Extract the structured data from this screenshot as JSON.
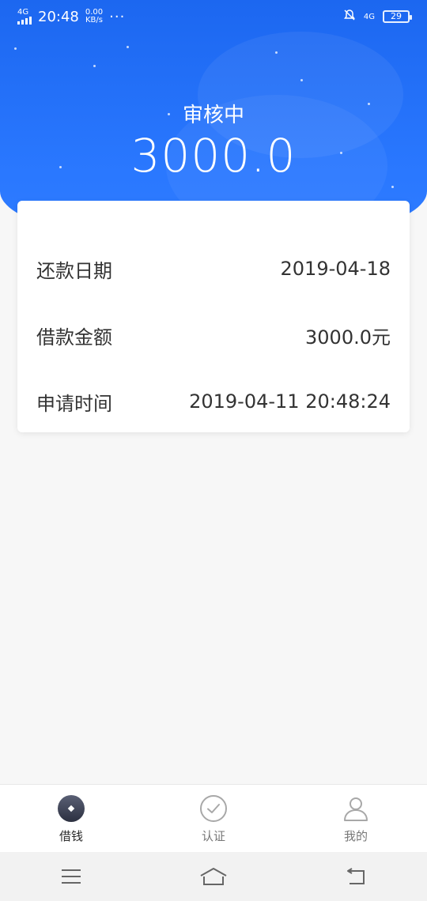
{
  "status_bar": {
    "network": "4G",
    "time": "20:48",
    "speed_value": "0.00",
    "speed_unit": "KB/s",
    "more": "···",
    "network_right": "4G",
    "battery": "29"
  },
  "loan": {
    "status_title": "审核中",
    "amount": "3000.0"
  },
  "details": [
    {
      "label": "还款日期",
      "value": "2019-04-18"
    },
    {
      "label": "借款金额",
      "value": "3000.0元"
    },
    {
      "label": "申请时间",
      "value": "2019-04-11 20:48:24"
    }
  ],
  "bottom_nav": {
    "items": [
      {
        "label": "借钱",
        "icon": "borrow-icon",
        "active": true
      },
      {
        "label": "认证",
        "icon": "check-circle-icon",
        "active": false
      },
      {
        "label": "我的",
        "icon": "user-icon",
        "active": false
      }
    ]
  },
  "colors": {
    "brand_blue": "#2a78ff",
    "card_bg": "#ffffff",
    "page_bg": "#f7f7f7"
  }
}
